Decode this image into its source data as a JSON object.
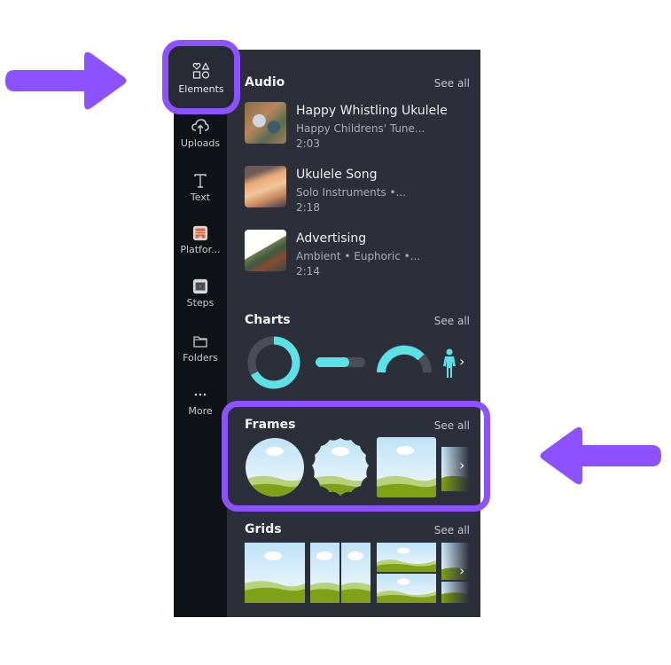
{
  "sidebar": {
    "items": [
      {
        "label": "Elements",
        "icon": "elements-shapes-icon",
        "active": true
      },
      {
        "label": "Uploads",
        "icon": "cloud-upload-icon"
      },
      {
        "label": "Text",
        "icon": "text-t-icon"
      },
      {
        "label": "Platfor...",
        "icon": "platform-app-icon"
      },
      {
        "label": "Steps",
        "icon": "steps-app-icon"
      },
      {
        "label": "Folders",
        "icon": "folder-icon"
      },
      {
        "label": "More",
        "icon": "more-dots-icon"
      }
    ]
  },
  "audio": {
    "title": "Audio",
    "see_all": "See all",
    "tracks": [
      {
        "title": "Happy Whistling Ukulele",
        "subtitle": "Happy Childrens' Tune...",
        "duration": "2:03"
      },
      {
        "title": "Ukulele Song",
        "subtitle": "Solo Instruments •...",
        "duration": "2:18"
      },
      {
        "title": "Advertising",
        "subtitle": "Ambient • Euphoric •...",
        "duration": "2:14"
      }
    ]
  },
  "charts": {
    "title": "Charts",
    "see_all": "See all",
    "next": "›"
  },
  "frames": {
    "title": "Frames",
    "see_all": "See all",
    "next": "›"
  },
  "grids": {
    "title": "Grids",
    "see_all": "See all",
    "next": "›"
  },
  "colors": {
    "accent": "#8c52ff",
    "chart": "#5ce1e6",
    "panel": "#2a2f3a",
    "sidebar": "#0e1116"
  }
}
